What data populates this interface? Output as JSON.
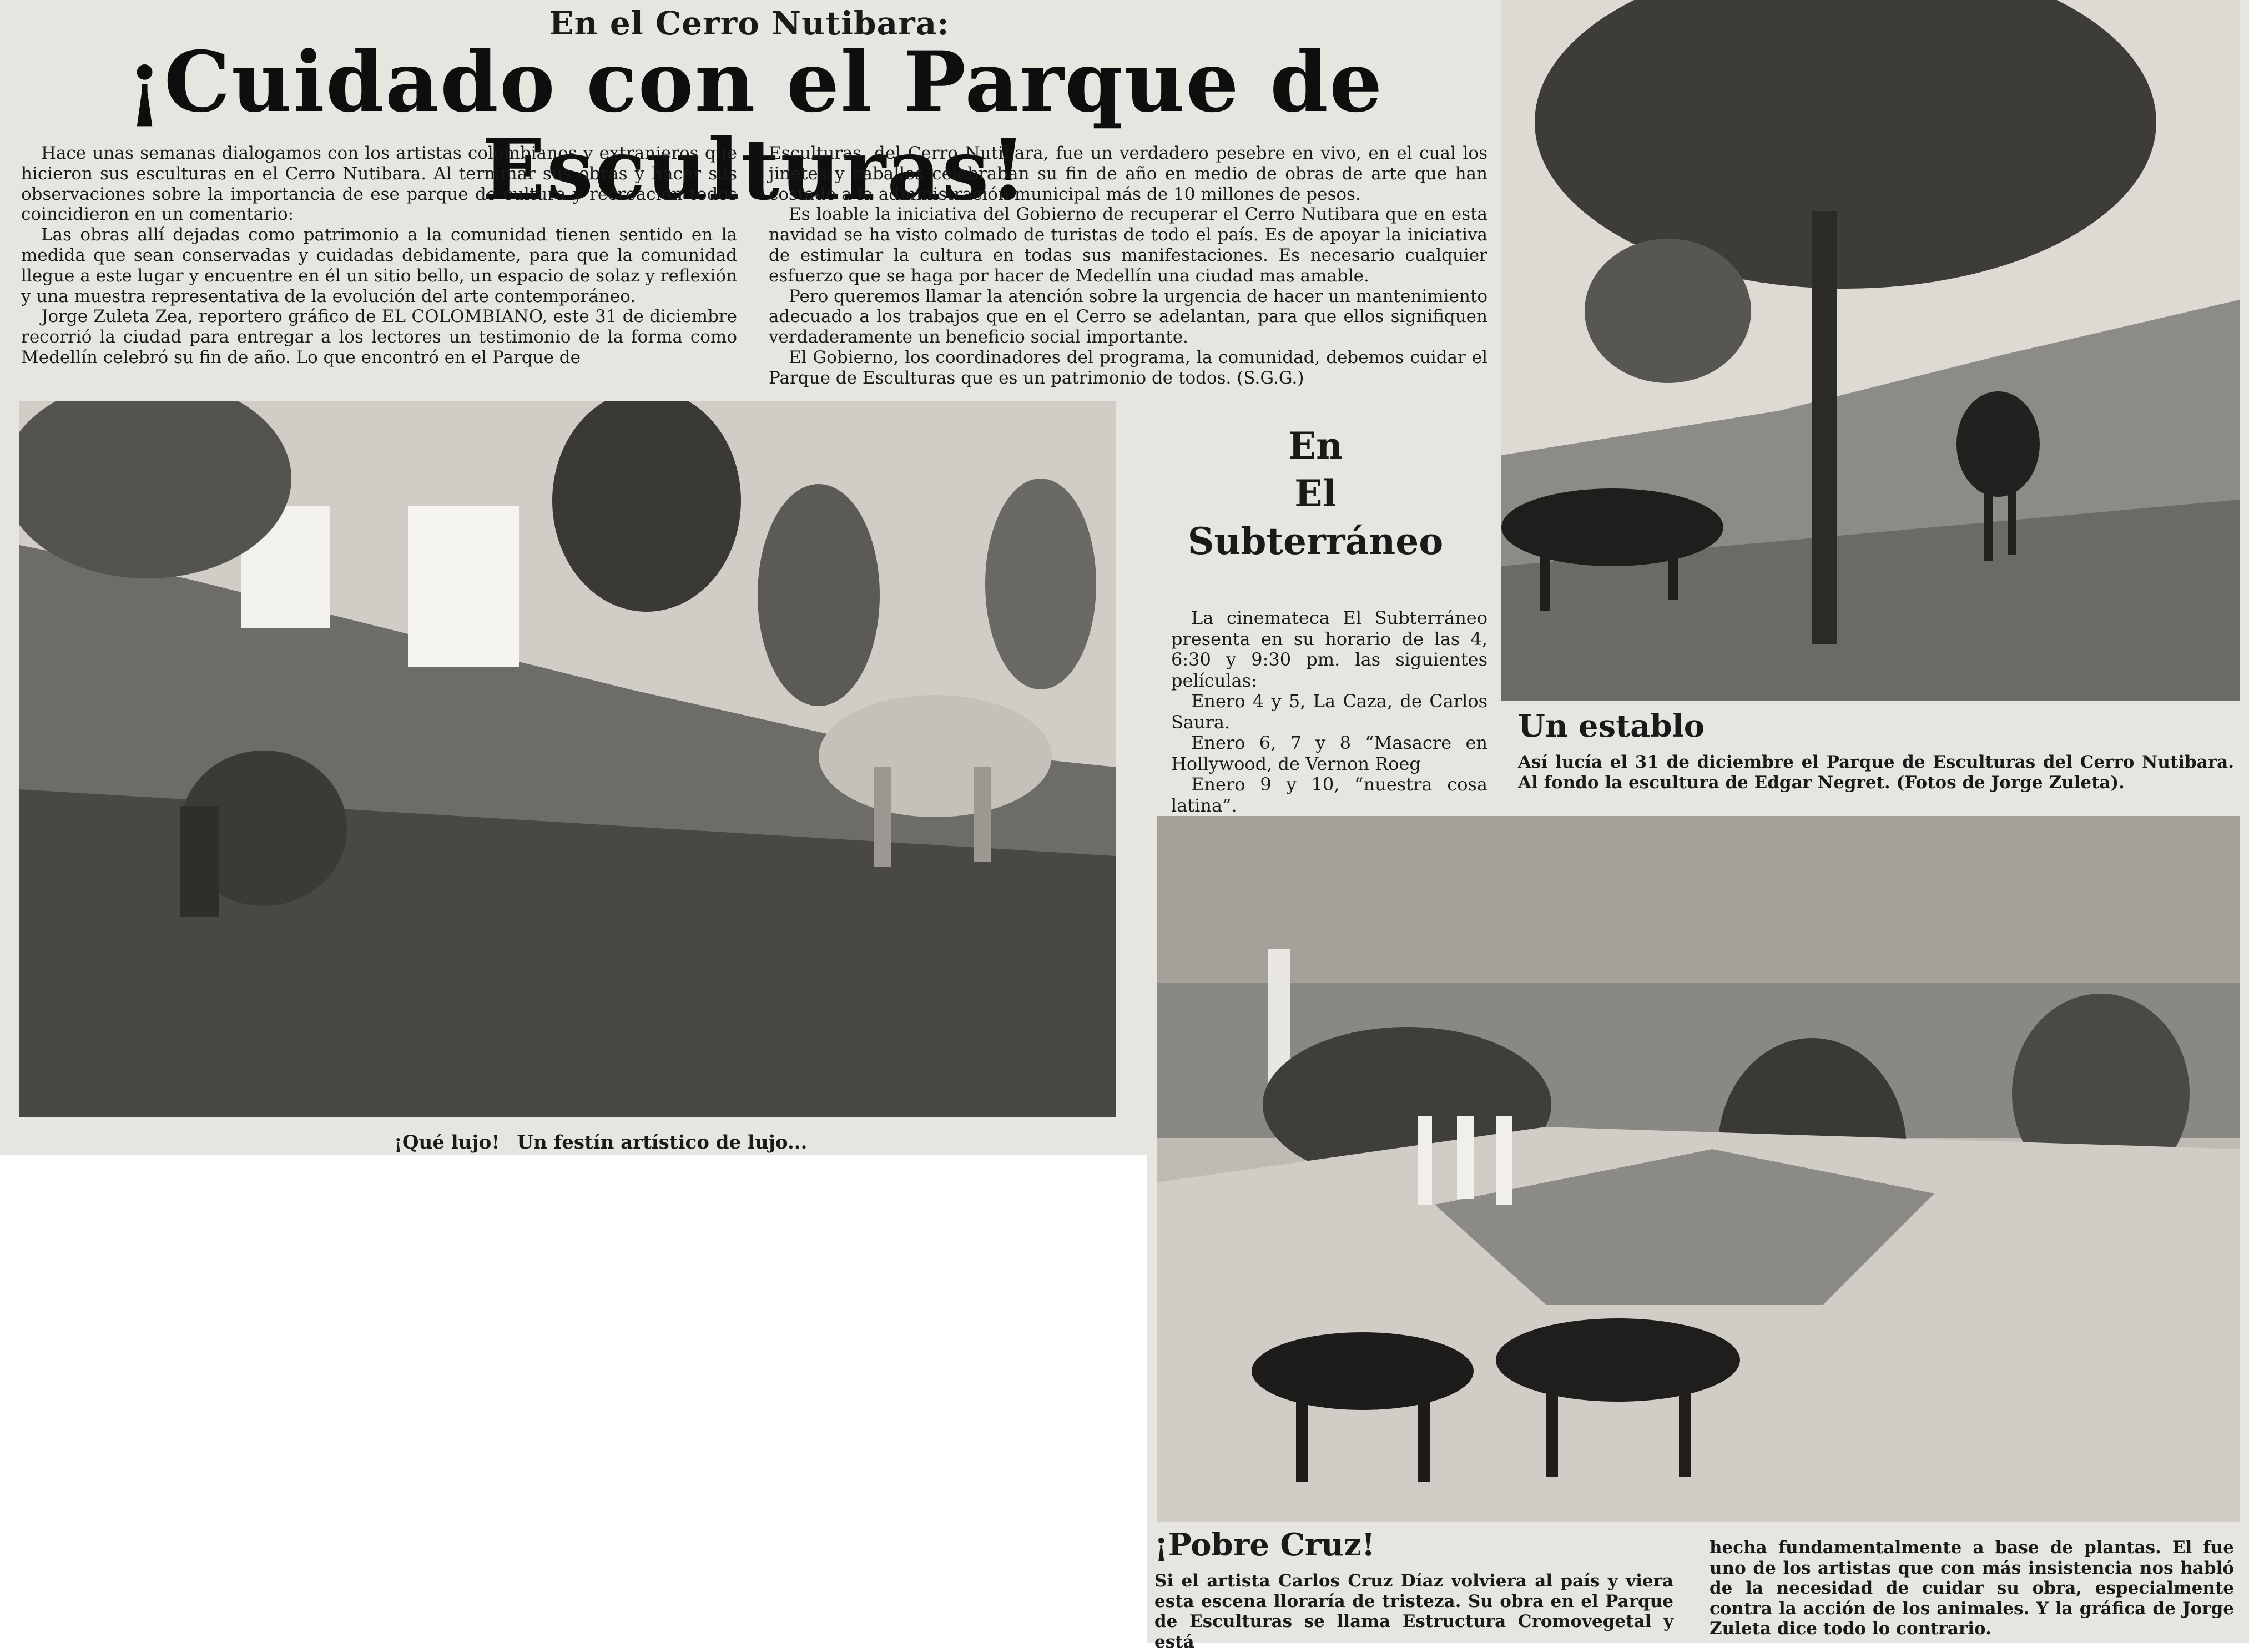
{
  "article": {
    "kicker": "En el Cerro Nutibara:",
    "headline": "¡Cuidado con el Parque  de Esculturas!",
    "col1": [
      "Hace unas semanas dialogamos con los artistas colombianos y extranjeros que hicieron sus esculturas en el Cerro Nutibara. Al terminar sus obras y hacer sus observaciones sobre la importancia de ese parque de cultura y recreación todos coincidieron en un comentario:",
      "Las obras allí dejadas como patrimonio a la comunidad tienen sentido en la medida que sean conservadas y cuidadas debidamente, para que la comunidad llegue a este lugar y encuentre en él un sitio bello, un espacio de solaz y reflexión y una muestra representativa de la evolución del arte contemporáneo.",
      "Jorge Zuleta Zea, reportero gráfico de EL COLOMBIANO, este 31 de diciembre recorrió la ciudad para entregar a los lectores un testimonio de la forma como Medellín celebró su fin de año. Lo que encontró en el Parque de"
    ],
    "col2": [
      "Esculturas, del Cerro Nutibara, fue un verdadero pesebre en vivo, en el cual los jinetes y caballos celebraban su fin de año en medio de obras de arte que han costado a la administración municipal más de 10 millones de pesos.",
      "Es loable la iniciativa del Gobierno de recuperar el Cerro Nutibara que en esta navidad se ha visto colmado de turistas de todo el país. Es de apoyar la iniciativa de estimular la cultura en todas sus manifestaciones. Es necesario cualquier esfuerzo que se haga por hacer de Medellín una ciudad mas amable.",
      "Pero queremos llamar la atención sobre la urgencia de hacer un mantenimiento adecuado a los trabajos que en el Cerro se adelantan, para que ellos signifiquen verdaderamente un beneficio social importante.",
      "El Gobierno, los coordinadores del programa, la comunidad, debemos cuidar el Parque de Esculturas que es un patrimonio de todos. (S.G.G.)"
    ]
  },
  "photo_left": {
    "caption_lead": "¡Qué lujo!",
    "caption_text": "Un festín artístico de lujo..."
  },
  "cinema": {
    "title_lines": [
      "En",
      "El",
      "Subterráneo"
    ],
    "paragraphs": [
      "La cinemateca El Subterráneo presenta en su horario de las 4, 6:30 y 9:30 pm. las siguientes películas:",
      "Enero 4 y 5, La Caza, de Carlos Saura.",
      "Enero 6, 7 y 8 “Masacre en Hollywood, de Vernon Roeg",
      "Enero 9 y 10, “nuestra cosa latina”."
    ]
  },
  "establo": {
    "title": "Un establo",
    "caption": "Así lucía el 31 de diciembre el Parque de Esculturas del Cerro Nutibara. Al fondo la escultura de Edgar Negret. (Fotos de Jorge Zuleta)."
  },
  "pobre_cruz": {
    "title": "¡Pobre Cruz!",
    "col1": "Si el artista Carlos Cruz Díaz volviera al país y viera esta escena lloraría de tristeza. Su obra en el Parque de Esculturas se llama Estructura Cromovegetal y está",
    "col2": "hecha fundamentalmente a base de plantas. El fue uno de los artistas que con más insistencia nos habló de la necesidad de cuidar su obra, especialmente contra la acción de los animales. Y la gráfica de Jorge Zuleta dice todo lo contrario."
  }
}
